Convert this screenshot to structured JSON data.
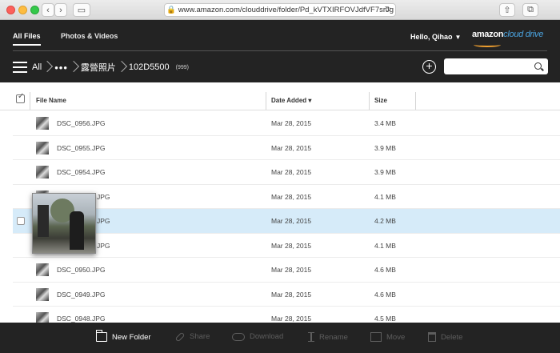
{
  "browser": {
    "url": "www.amazon.com/clouddrive/folder/Pd_kVTXIRFOVJdfVF7srJg",
    "back_icon": "chevron-left-icon",
    "forward_icon": "chevron-right-icon",
    "sidebar_icon": "sidebar-icon",
    "share_icon": "share-icon",
    "tabs_icon": "tabs-icon"
  },
  "header": {
    "tabs": [
      {
        "label": "All Files",
        "active": true
      },
      {
        "label": "Photos & Videos",
        "active": false
      }
    ],
    "greeting": "Hello, Qihao",
    "logo_text": "amazon",
    "logo_suffix": "cloud drive"
  },
  "breadcrumb": {
    "root": "All",
    "ellipsis": "•••",
    "parent": "露營照片",
    "current": "102D5500",
    "count": "(999)"
  },
  "search": {
    "placeholder": ""
  },
  "table": {
    "columns": {
      "name": "File Name",
      "date": "Date Added",
      "size": "Size"
    },
    "rows": [
      {
        "name": "DSC_0956.JPG",
        "date": "Mar 28, 2015",
        "size": "3.4 MB",
        "selected": false
      },
      {
        "name": "DSC_0955.JPG",
        "date": "Mar 28, 2015",
        "size": "3.9 MB",
        "selected": false
      },
      {
        "name": "DSC_0954.JPG",
        "date": "Mar 28, 2015",
        "size": "3.9 MB",
        "selected": false
      },
      {
        "name": "JPG",
        "date": "Mar 28, 2015",
        "size": "4.1 MB",
        "selected": false
      },
      {
        "name": "JPG",
        "date": "Mar 28, 2015",
        "size": "4.2 MB",
        "selected": true
      },
      {
        "name": "JPG",
        "date": "Mar 28, 2015",
        "size": "4.1 MB",
        "selected": false
      },
      {
        "name": "DSC_0950.JPG",
        "date": "Mar 28, 2015",
        "size": "4.6 MB",
        "selected": false
      },
      {
        "name": "DSC_0949.JPG",
        "date": "Mar 28, 2015",
        "size": "4.6 MB",
        "selected": false
      },
      {
        "name": "DSC_0948.JPG",
        "date": "Mar 28, 2015",
        "size": "4.5 MB",
        "selected": false
      }
    ]
  },
  "toolbar": {
    "new_folder": "New Folder",
    "share": "Share",
    "download": "Download",
    "rename": "Rename",
    "move": "Move",
    "delete": "Delete"
  }
}
